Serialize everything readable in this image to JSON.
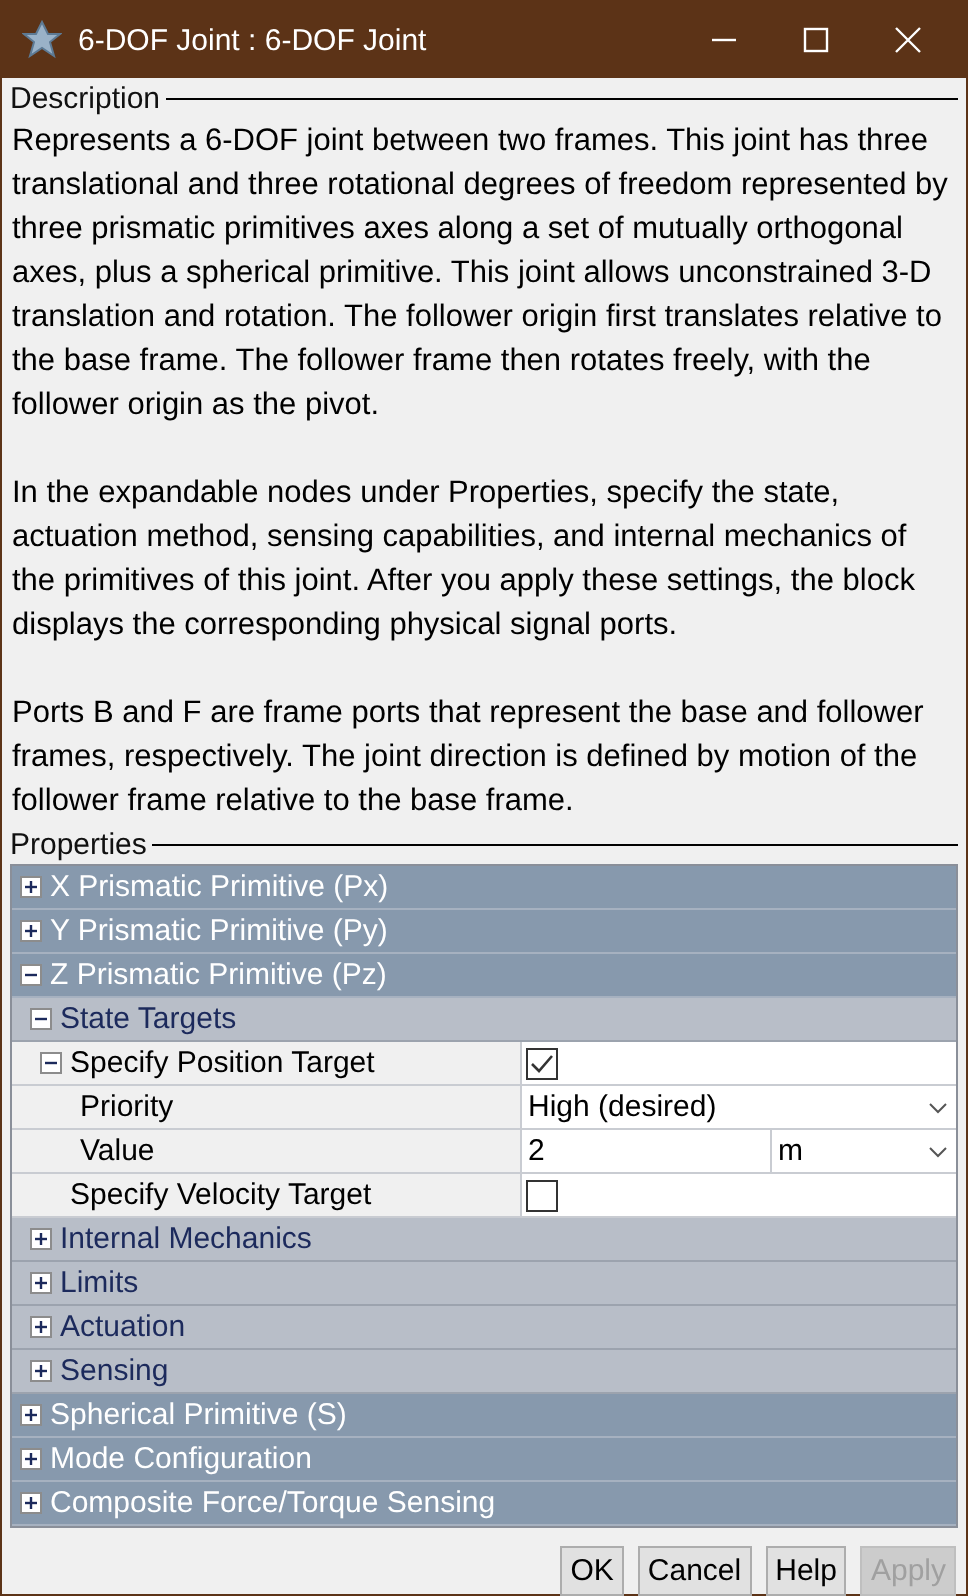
{
  "window": {
    "title": "6-DOF Joint : 6-DOF Joint"
  },
  "description": {
    "label": "Description",
    "paragraphs": [
      "Represents a 6-DOF joint between two frames. This joint has three translational and three rotational degrees of freedom represented by three prismatic primitives axes along a set of mutually orthogonal axes, plus a spherical primitive. This joint allows unconstrained 3-D translation and rotation. The follower origin first translates relative to the base frame. The follower frame then rotates freely, with the follower origin as the pivot.",
      "In the expandable nodes under Properties, specify the state, actuation method, sensing capabilities, and internal mechanics of the primitives of this joint. After you apply these settings, the block displays the corresponding physical signal ports.",
      "Ports B and F are frame ports that represent the base and follower frames, respectively. The joint direction is defined by motion of the follower frame relative to the base frame."
    ]
  },
  "properties": {
    "label": "Properties",
    "nodes": [
      {
        "label": "X Prismatic Primitive (Px)",
        "expanded": false
      },
      {
        "label": "Y Prismatic Primitive (Py)",
        "expanded": false
      },
      {
        "label": "Z Prismatic Primitive (Pz)",
        "expanded": true,
        "children": [
          {
            "label": "State Targets",
            "expanded": true,
            "children": [
              {
                "label": "Specify Position Target",
                "kind": "checkbox",
                "checked": true,
                "expanded": true,
                "children": [
                  {
                    "label": "Priority",
                    "kind": "dropdown",
                    "value": "High (desired)"
                  },
                  {
                    "label": "Value",
                    "kind": "value_unit",
                    "value": "2",
                    "unit": "m"
                  }
                ]
              },
              {
                "label": "Specify Velocity Target",
                "kind": "checkbox",
                "checked": false
              }
            ]
          },
          {
            "label": "Internal Mechanics",
            "expanded": false
          },
          {
            "label": "Limits",
            "expanded": false
          },
          {
            "label": "Actuation",
            "expanded": false
          },
          {
            "label": "Sensing",
            "expanded": false
          }
        ]
      },
      {
        "label": "Spherical Primitive (S)",
        "expanded": false
      },
      {
        "label": "Mode Configuration",
        "expanded": false
      },
      {
        "label": "Composite Force/Torque Sensing",
        "expanded": false
      }
    ]
  },
  "buttons": [
    {
      "label": "OK",
      "disabled": false
    },
    {
      "label": "Cancel",
      "disabled": false
    },
    {
      "label": "Help",
      "disabled": false
    },
    {
      "label": "Apply",
      "disabled": true
    }
  ]
}
